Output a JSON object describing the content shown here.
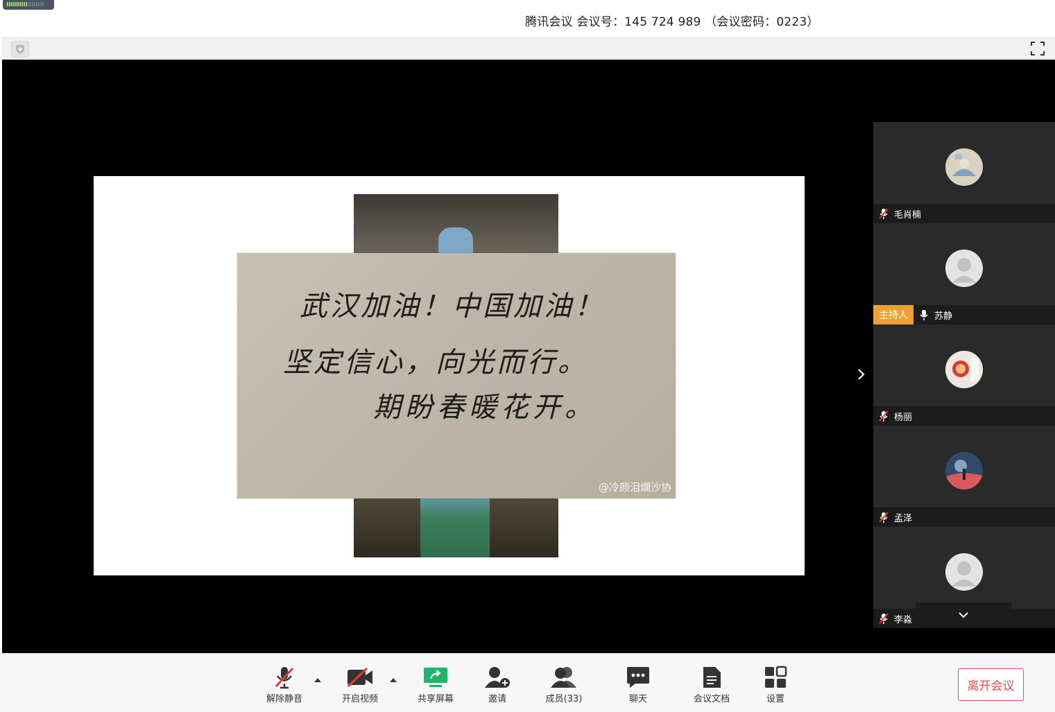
{
  "window": {
    "title": "腾讯会议 会议号：145 724 989 （会议密码：0223）"
  },
  "shared_content": {
    "note_lines": [
      "武汉加油！中国加油！",
      "坚定信心，向光而行。",
      "期盼春暖花开。"
    ],
    "watermark": "@冷颜泪爛沙协"
  },
  "participants": [
    {
      "name": "毛肖楠",
      "muted": true,
      "host": false,
      "avatar": "photo"
    },
    {
      "name": "苏静",
      "muted": false,
      "host": true,
      "host_label": "主持人",
      "avatar": "default"
    },
    {
      "name": "杨丽",
      "muted": true,
      "host": false,
      "avatar": "photo"
    },
    {
      "name": "孟泽",
      "muted": true,
      "host": false,
      "avatar": "photo"
    },
    {
      "name": "李淼",
      "muted": true,
      "host": false,
      "avatar": "default"
    }
  ],
  "toolbar": {
    "unmute": "解除静音",
    "start_video": "开启视频",
    "share_screen": "共享屏幕",
    "invite": "邀请",
    "members": "成员(33)",
    "chat": "聊天",
    "docs": "会议文档",
    "settings": "设置",
    "leave": "离开会议"
  },
  "colors": {
    "accent_green": "#1db56c",
    "leave_red": "#e84b4b",
    "host_orange": "#f0a030",
    "mute_red": "#e53935"
  }
}
